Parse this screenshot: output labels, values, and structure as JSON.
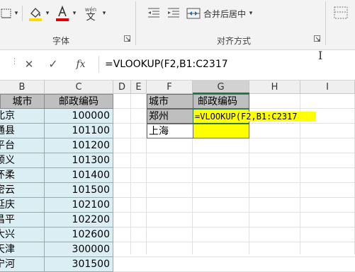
{
  "ribbon": {
    "font_group_label": "字体",
    "align_group_label": "对齐方式",
    "merge_label": "合并后居中",
    "wen_label": "wén",
    "wen_char": "文",
    "icons": [
      "borders-icon",
      "fill-color-icon",
      "font-color-icon",
      "phonetic-icon",
      "wrap-text-icon",
      "merge-center-icon",
      "launcher-icon"
    ]
  },
  "formula_bar": {
    "cancel_icon": "✕",
    "enter_icon": "✓",
    "fx_label": "fx",
    "formula": "=VLOOKUP(F2,B1:C2317"
  },
  "columns": [
    "B",
    "C",
    "D",
    "E",
    "F",
    "G",
    "H",
    "I"
  ],
  "table1": {
    "header": [
      "城市",
      "邮政编码"
    ],
    "rows": [
      [
        "北京",
        "100000"
      ],
      [
        "通县",
        "101100"
      ],
      [
        "平台",
        "101200"
      ],
      [
        "顺义",
        "101300"
      ],
      [
        "怀柔",
        "101400"
      ],
      [
        "密云",
        "101500"
      ],
      [
        "延庆",
        "102100"
      ],
      [
        "昌平",
        "102200"
      ],
      [
        "大兴",
        "102600"
      ],
      [
        "天津",
        "300000"
      ],
      [
        "宁河",
        "301500"
      ]
    ]
  },
  "table2": {
    "header": [
      "城市",
      "邮政编码"
    ],
    "rows": [
      [
        "郑州",
        "=VLOOKUP(F2,B1:C2317"
      ],
      [
        "上海",
        ""
      ]
    ]
  },
  "colors": {
    "cyan_fill": "#dbeef4",
    "header_fill": "#bfbfbf",
    "yellow_fill": "#ffff00",
    "selected_border": "#217346"
  }
}
